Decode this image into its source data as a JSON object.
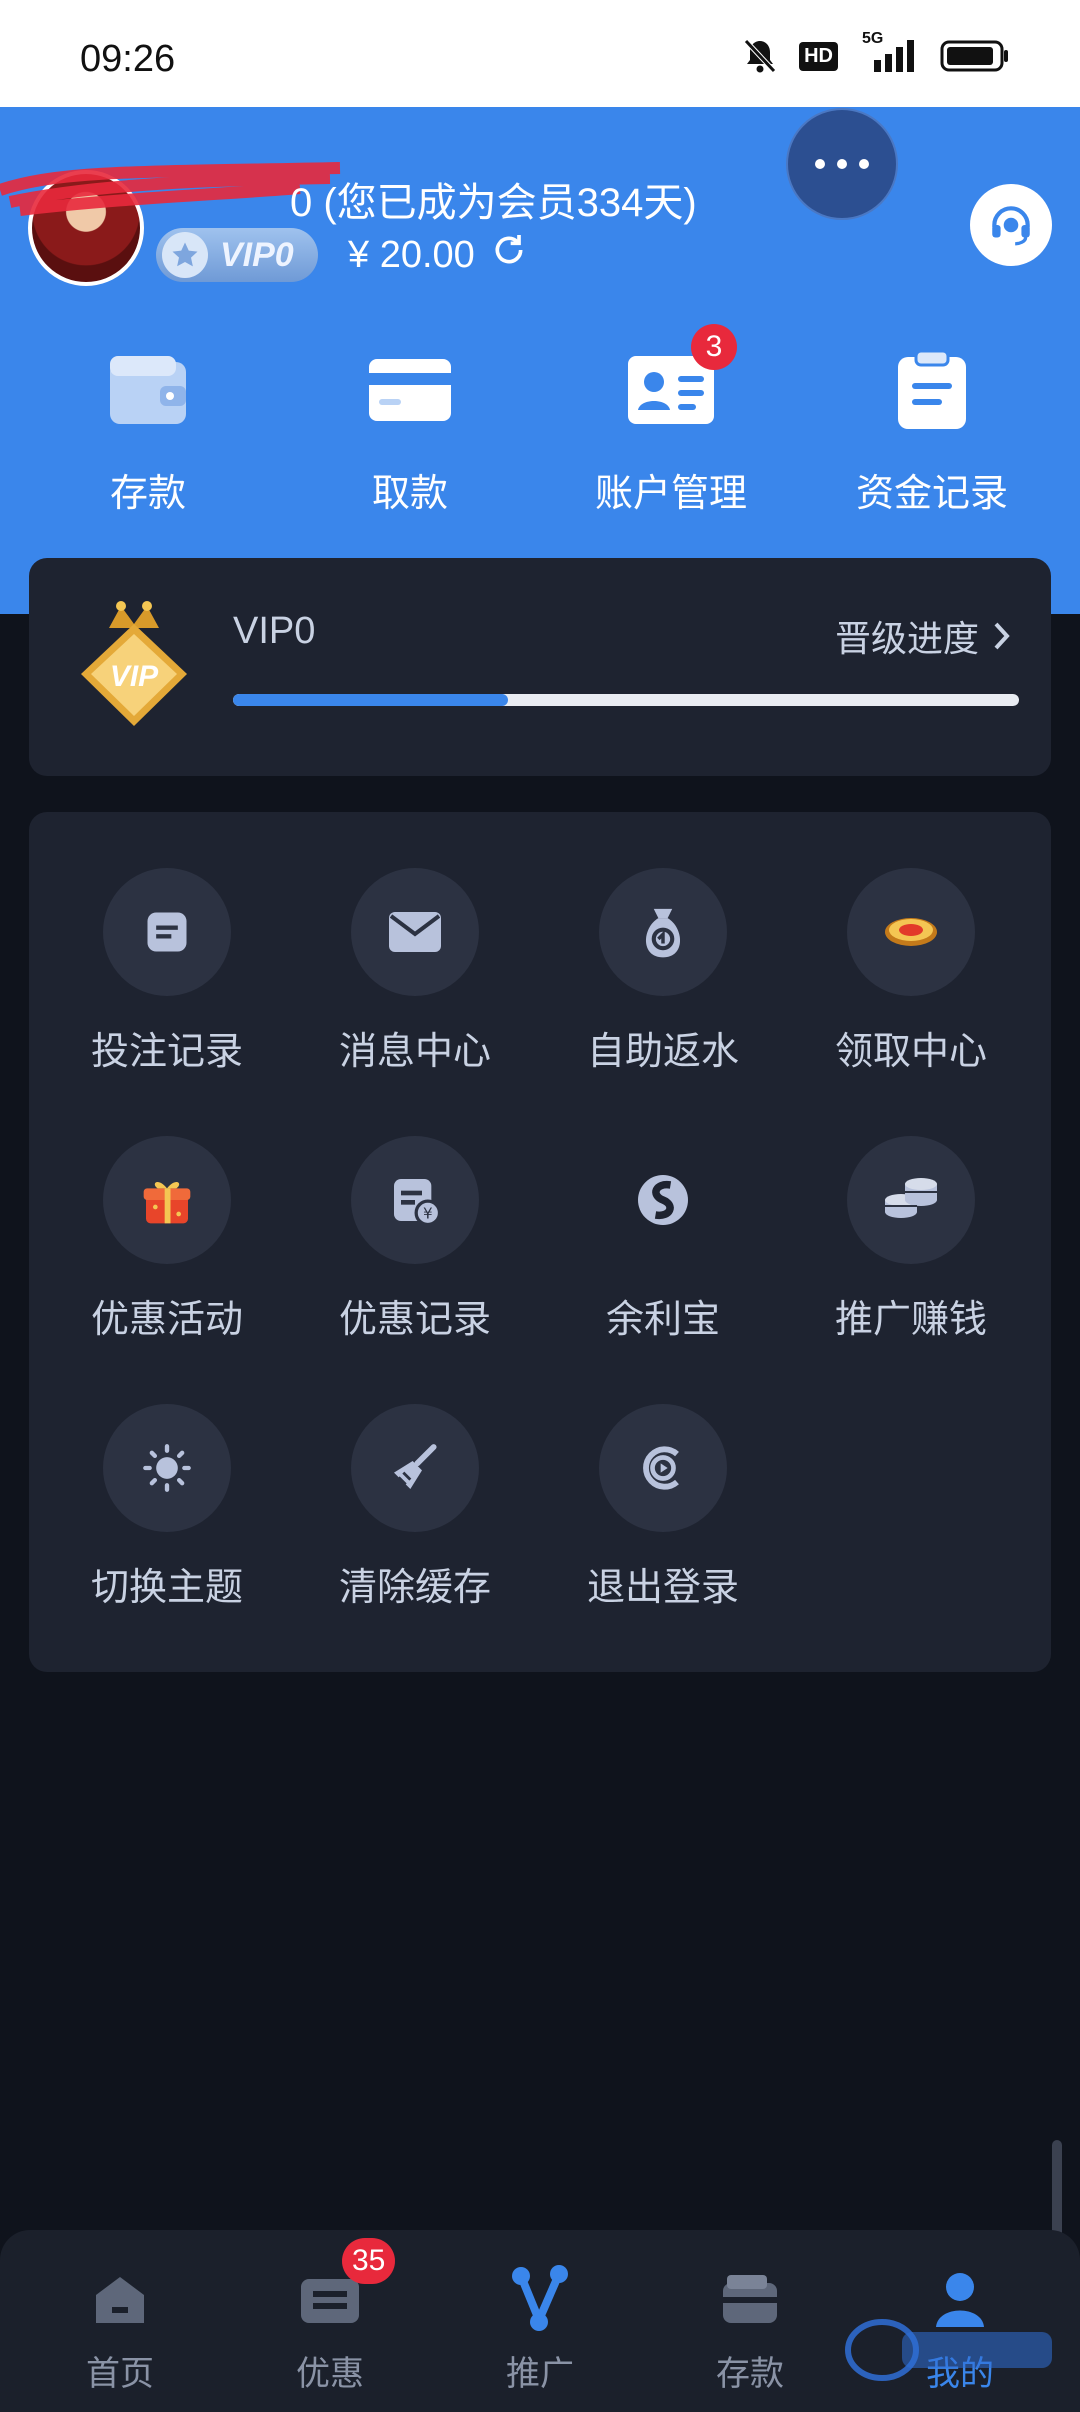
{
  "status_bar": {
    "time": "09:26",
    "network": "5G",
    "hd": "HD"
  },
  "header": {
    "member_text": "0 (您已成为会员334天)",
    "vip_badge": "VIP0",
    "balance": "¥ 20.00"
  },
  "quick_actions": [
    {
      "label": "存款",
      "icon": "wallet-icon"
    },
    {
      "label": "取款",
      "icon": "card-icon"
    },
    {
      "label": "账户管理",
      "icon": "id-card-icon",
      "badge": "3"
    },
    {
      "label": "资金记录",
      "icon": "clipboard-icon"
    }
  ],
  "vip_card": {
    "level": "VIP0",
    "progress_link": "晋级进度",
    "progress": 0.35,
    "crown_text": "VIP"
  },
  "menu": [
    {
      "label": "投注记录",
      "icon": "bet-record-icon"
    },
    {
      "label": "消息中心",
      "icon": "mail-icon"
    },
    {
      "label": "自助返水",
      "icon": "money-bag-icon"
    },
    {
      "label": "领取中心",
      "icon": "coin-icon"
    },
    {
      "label": "优惠活动",
      "icon": "gift-icon"
    },
    {
      "label": "优惠记录",
      "icon": "yuan-record-icon"
    },
    {
      "label": "余利宝",
      "icon": "yulibao-icon"
    },
    {
      "label": "推广赚钱",
      "icon": "coins-stack-icon"
    },
    {
      "label": "切换主题",
      "icon": "sun-icon"
    },
    {
      "label": "清除缓存",
      "icon": "broom-icon"
    },
    {
      "label": "退出登录",
      "icon": "logout-icon"
    }
  ],
  "tabbar": [
    {
      "label": "首页",
      "icon": "home-icon"
    },
    {
      "label": "优惠",
      "icon": "ticket-icon",
      "badge": "35"
    },
    {
      "label": "推广",
      "icon": "share-icon"
    },
    {
      "label": "存款",
      "icon": "wallet-icon"
    },
    {
      "label": "我的",
      "icon": "user-icon",
      "active": true
    }
  ],
  "colors": {
    "accent": "#3a86eb",
    "background": "#0f131c",
    "card": "#1e2330",
    "badge": "#e8293c"
  }
}
